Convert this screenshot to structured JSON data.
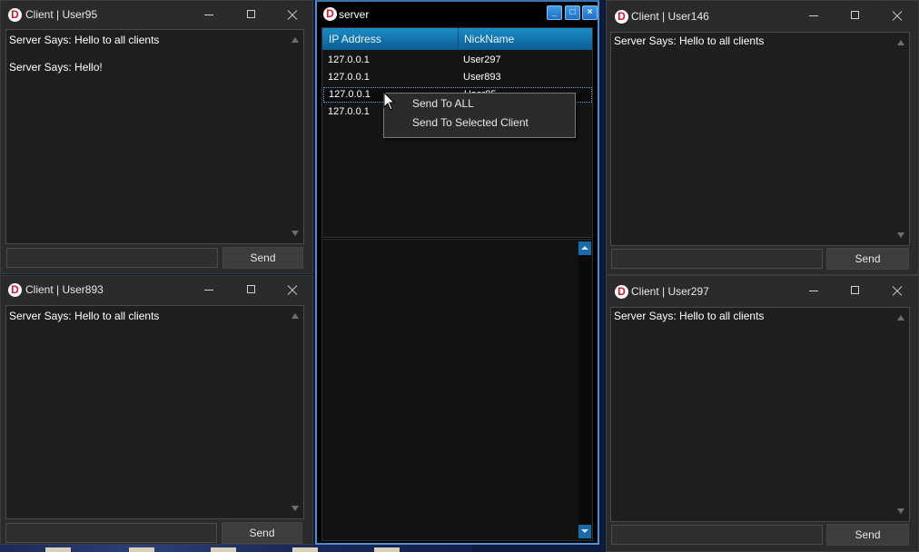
{
  "client_user95": {
    "title": "Client | User95",
    "messages": [
      "Server Says: Hello to all clients",
      "Server Says: Hello!"
    ],
    "input_value": "",
    "send_label": "Send"
  },
  "client_user893": {
    "title": "Client | User893",
    "messages": [
      "Server Says: Hello to all clients"
    ],
    "input_value": "",
    "send_label": "Send"
  },
  "client_user146": {
    "title": "Client | User146",
    "messages": [
      "Server Says: Hello to all clients"
    ],
    "input_value": "",
    "send_label": "Send"
  },
  "client_user297": {
    "title": "Client | User297",
    "messages": [
      "Server Says: Hello to all clients"
    ],
    "input_value": "",
    "send_label": "Send"
  },
  "server": {
    "title": "server",
    "window_buttons": [
      "_",
      "□",
      "×"
    ],
    "columns": [
      "IP Address",
      "NickName"
    ],
    "rows": [
      {
        "ip": "127.0.0.1",
        "nick": "User297"
      },
      {
        "ip": "127.0.0.1",
        "nick": "User893"
      },
      {
        "ip": "127.0.0.1",
        "nick": "User95"
      },
      {
        "ip": "127.0.0.1",
        "nick": ""
      }
    ]
  },
  "context_menu": {
    "items": [
      "Send To ALL",
      "Send To Selected Client"
    ]
  },
  "colors": {
    "client_bg": "#2b2b2b",
    "server_header": "#1b8bc6",
    "server_border": "#4b8ed1",
    "logo_red": "#d11a2a"
  }
}
